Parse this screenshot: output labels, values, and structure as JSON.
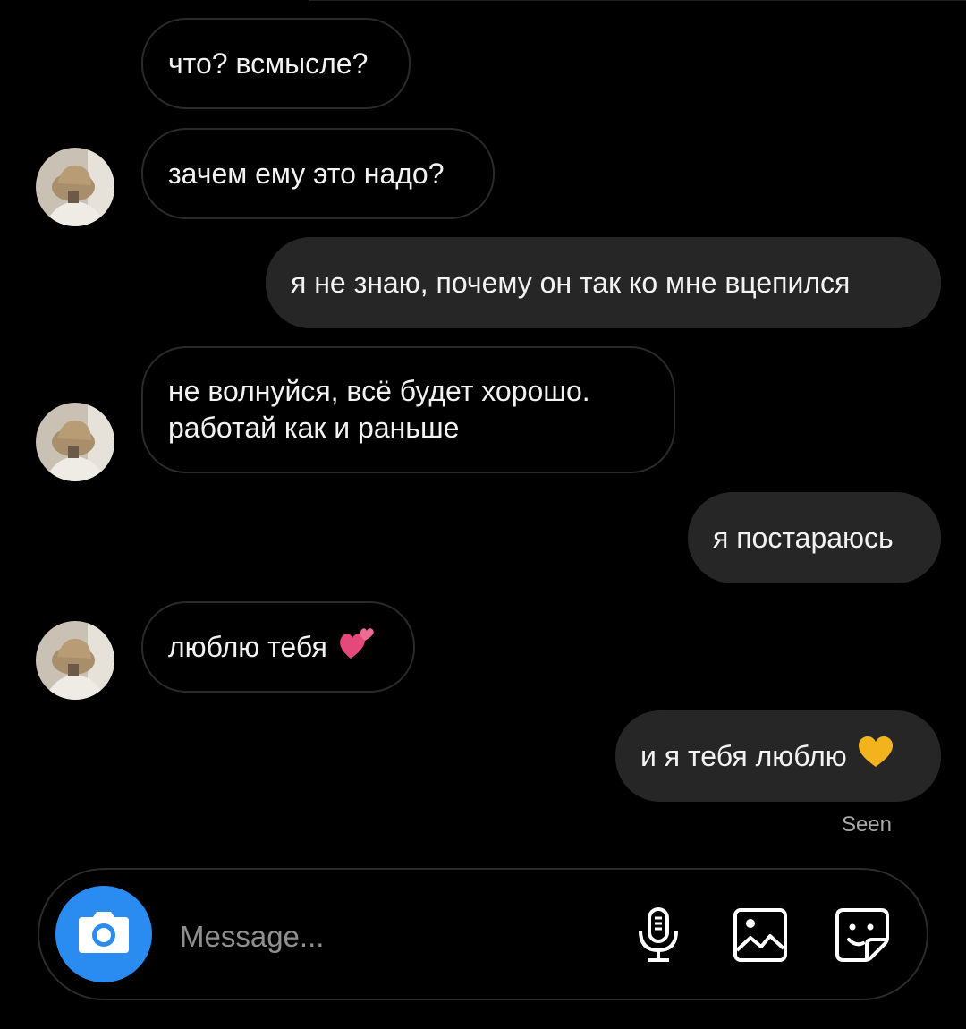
{
  "thread": {
    "messages": [
      {
        "id": 1,
        "direction": "incoming",
        "text": "что? всмысле?",
        "avatar": false
      },
      {
        "id": 2,
        "direction": "incoming",
        "text": "зачем ему это надо?",
        "avatar": true
      },
      {
        "id": 3,
        "direction": "outgoing",
        "text": "я не знаю, почему он так ко мне вцепился"
      },
      {
        "id": 4,
        "direction": "incoming",
        "lines": [
          "не волнуйся, всё будет хорошо.",
          "работай как и раньше"
        ],
        "avatar": true
      },
      {
        "id": 5,
        "direction": "outgoing",
        "text": "я постараюсь"
      },
      {
        "id": 6,
        "direction": "incoming",
        "text": "люблю тебя",
        "emoji": "two-hearts-icon",
        "avatar": true
      },
      {
        "id": 7,
        "direction": "outgoing",
        "text": "и я тебя люблю",
        "emoji": "yellow-heart-icon"
      }
    ],
    "seen_label": "Seen"
  },
  "composer": {
    "placeholder": "Message...",
    "icons": [
      "camera-icon",
      "microphone-icon",
      "gallery-icon",
      "sticker-icon"
    ]
  },
  "colors": {
    "background": "#000000",
    "outgoing_bubble": "#262626",
    "incoming_border": "#2a2a2a",
    "camera_button": "#2a8cf0",
    "pink_heart": "#e5487a",
    "yellow_heart": "#f2b31c"
  }
}
